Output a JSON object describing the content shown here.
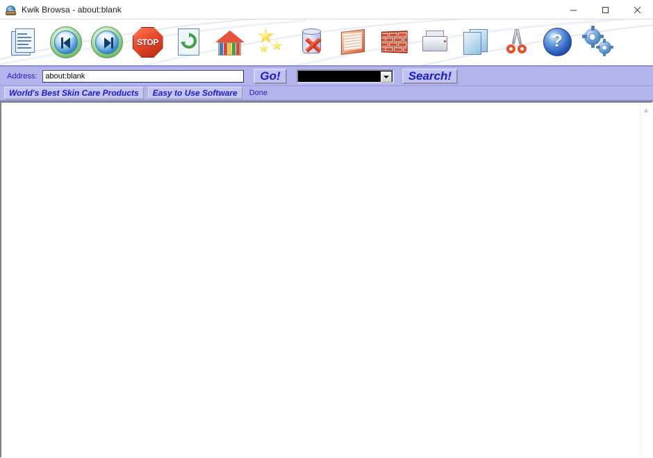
{
  "window": {
    "title": "Kwik Browsa - about:blank",
    "app_icon": "globe-icon",
    "controls": {
      "minimize": "minimize-icon",
      "maximize": "maximize-icon",
      "close": "close-icon"
    }
  },
  "toolbar": {
    "buttons": [
      {
        "name": "new-page",
        "icon": "document-pages-icon",
        "label": "New Page"
      },
      {
        "name": "back",
        "icon": "back-arrow-icon",
        "label": "Back"
      },
      {
        "name": "forward",
        "icon": "forward-arrow-icon",
        "label": "Forward"
      },
      {
        "name": "stop",
        "icon": "stop-sign-icon",
        "label": "STOP"
      },
      {
        "name": "refresh",
        "icon": "refresh-recycle-icon",
        "label": "Refresh"
      },
      {
        "name": "home",
        "icon": "house-icon",
        "label": "Home"
      },
      {
        "name": "favorites",
        "icon": "stars-icon",
        "label": "Favorites"
      },
      {
        "name": "clear-cache",
        "icon": "database-delete-icon",
        "label": "Clear Cache"
      },
      {
        "name": "history",
        "icon": "book-icon",
        "label": "History"
      },
      {
        "name": "firewall",
        "icon": "brick-wall-icon",
        "label": "Firewall"
      },
      {
        "name": "print",
        "icon": "printer-icon",
        "label": "Print"
      },
      {
        "name": "copy-page",
        "icon": "copy-pages-icon",
        "label": "Copy"
      },
      {
        "name": "cut",
        "icon": "scissors-icon",
        "label": "Cut"
      },
      {
        "name": "help",
        "icon": "help-question-icon",
        "label": "Help"
      },
      {
        "name": "settings",
        "icon": "gears-icon",
        "label": "Settings"
      }
    ]
  },
  "address_bar": {
    "label": "Address:",
    "value": "about:blank",
    "placeholder": "",
    "go_label": "Go!",
    "search_label": "Search!",
    "engine_value": "",
    "engine_icon": "chevron-down-icon"
  },
  "links_bar": {
    "links": [
      {
        "name": "skin-care-products",
        "label": "World's Best Skin Care Products"
      },
      {
        "name": "easy-software",
        "label": "Easy to Use Software"
      }
    ],
    "status": "Done"
  },
  "content": {
    "body_text": "",
    "scroll_up_icon": "chevron-up-icon"
  },
  "colors": {
    "chrome_lavender": "#b4b4ec",
    "link_blue": "#1a1ad0",
    "accent_border": "#8e8ed6"
  }
}
